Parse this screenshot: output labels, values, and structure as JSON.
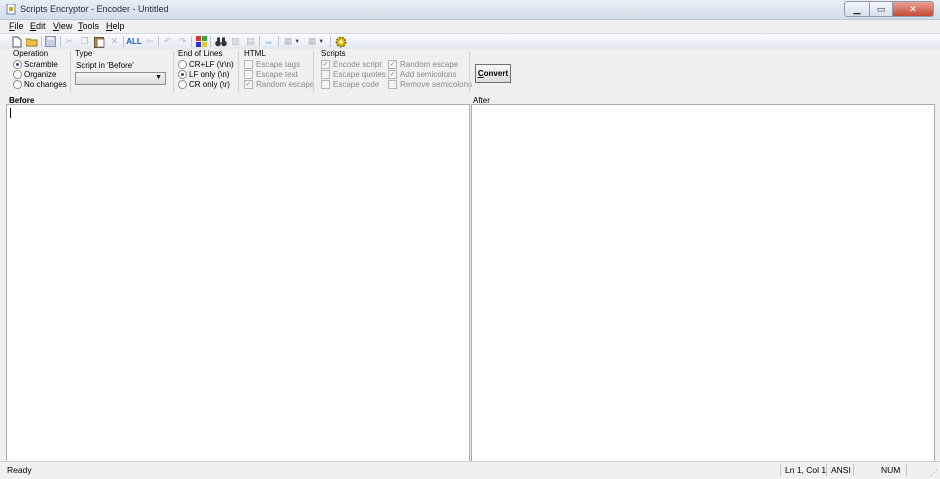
{
  "window": {
    "title": "Scripts Encryptor - Encoder - Untitled"
  },
  "menu": [
    {
      "label": "File",
      "u": "F",
      "rest": "ile"
    },
    {
      "label": "Edit",
      "u": "E",
      "rest": "dit"
    },
    {
      "label": "View",
      "u": "V",
      "rest": "iew"
    },
    {
      "label": "Tools",
      "u": "T",
      "rest": "ools"
    },
    {
      "label": "Help",
      "u": "H",
      "rest": "elp"
    }
  ],
  "toolbar": {
    "select_all_label": "ALL"
  },
  "operation": {
    "label": "Operation",
    "options": [
      "Scramble",
      "Organize",
      "No changes"
    ],
    "selected": "Scramble"
  },
  "type": {
    "label": "Type",
    "caption": "Script in 'Before'",
    "selected": ""
  },
  "eol": {
    "label": "End of Lines",
    "options": [
      "CR+LF (\\r\\n)",
      "LF only (\\n)",
      "CR only (\\r)"
    ],
    "selected": "LF only (\\n)"
  },
  "html": {
    "label": "HTML",
    "options": [
      {
        "label": "Escape tags",
        "checked": false
      },
      {
        "label": "Escape text",
        "checked": false
      },
      {
        "label": "Random escape",
        "checked": true
      }
    ]
  },
  "scripts": {
    "label": "Scripts",
    "col1": [
      {
        "label": "Encode script",
        "checked": true
      },
      {
        "label": "Escape quotes",
        "checked": false
      },
      {
        "label": "Escape code",
        "checked": false
      }
    ],
    "col2": [
      {
        "label": "Random escape",
        "checked": true
      },
      {
        "label": "Add semicolons",
        "checked": true
      },
      {
        "label": "Remove semicolons",
        "checked": false
      }
    ]
  },
  "convert": {
    "u": "C",
    "rest": "onvert"
  },
  "panels": {
    "before": "Before",
    "after": "After"
  },
  "status": {
    "ready": "Ready",
    "position": "Ln 1, Col 1",
    "encoding": "ANSI",
    "num": "NUM"
  }
}
